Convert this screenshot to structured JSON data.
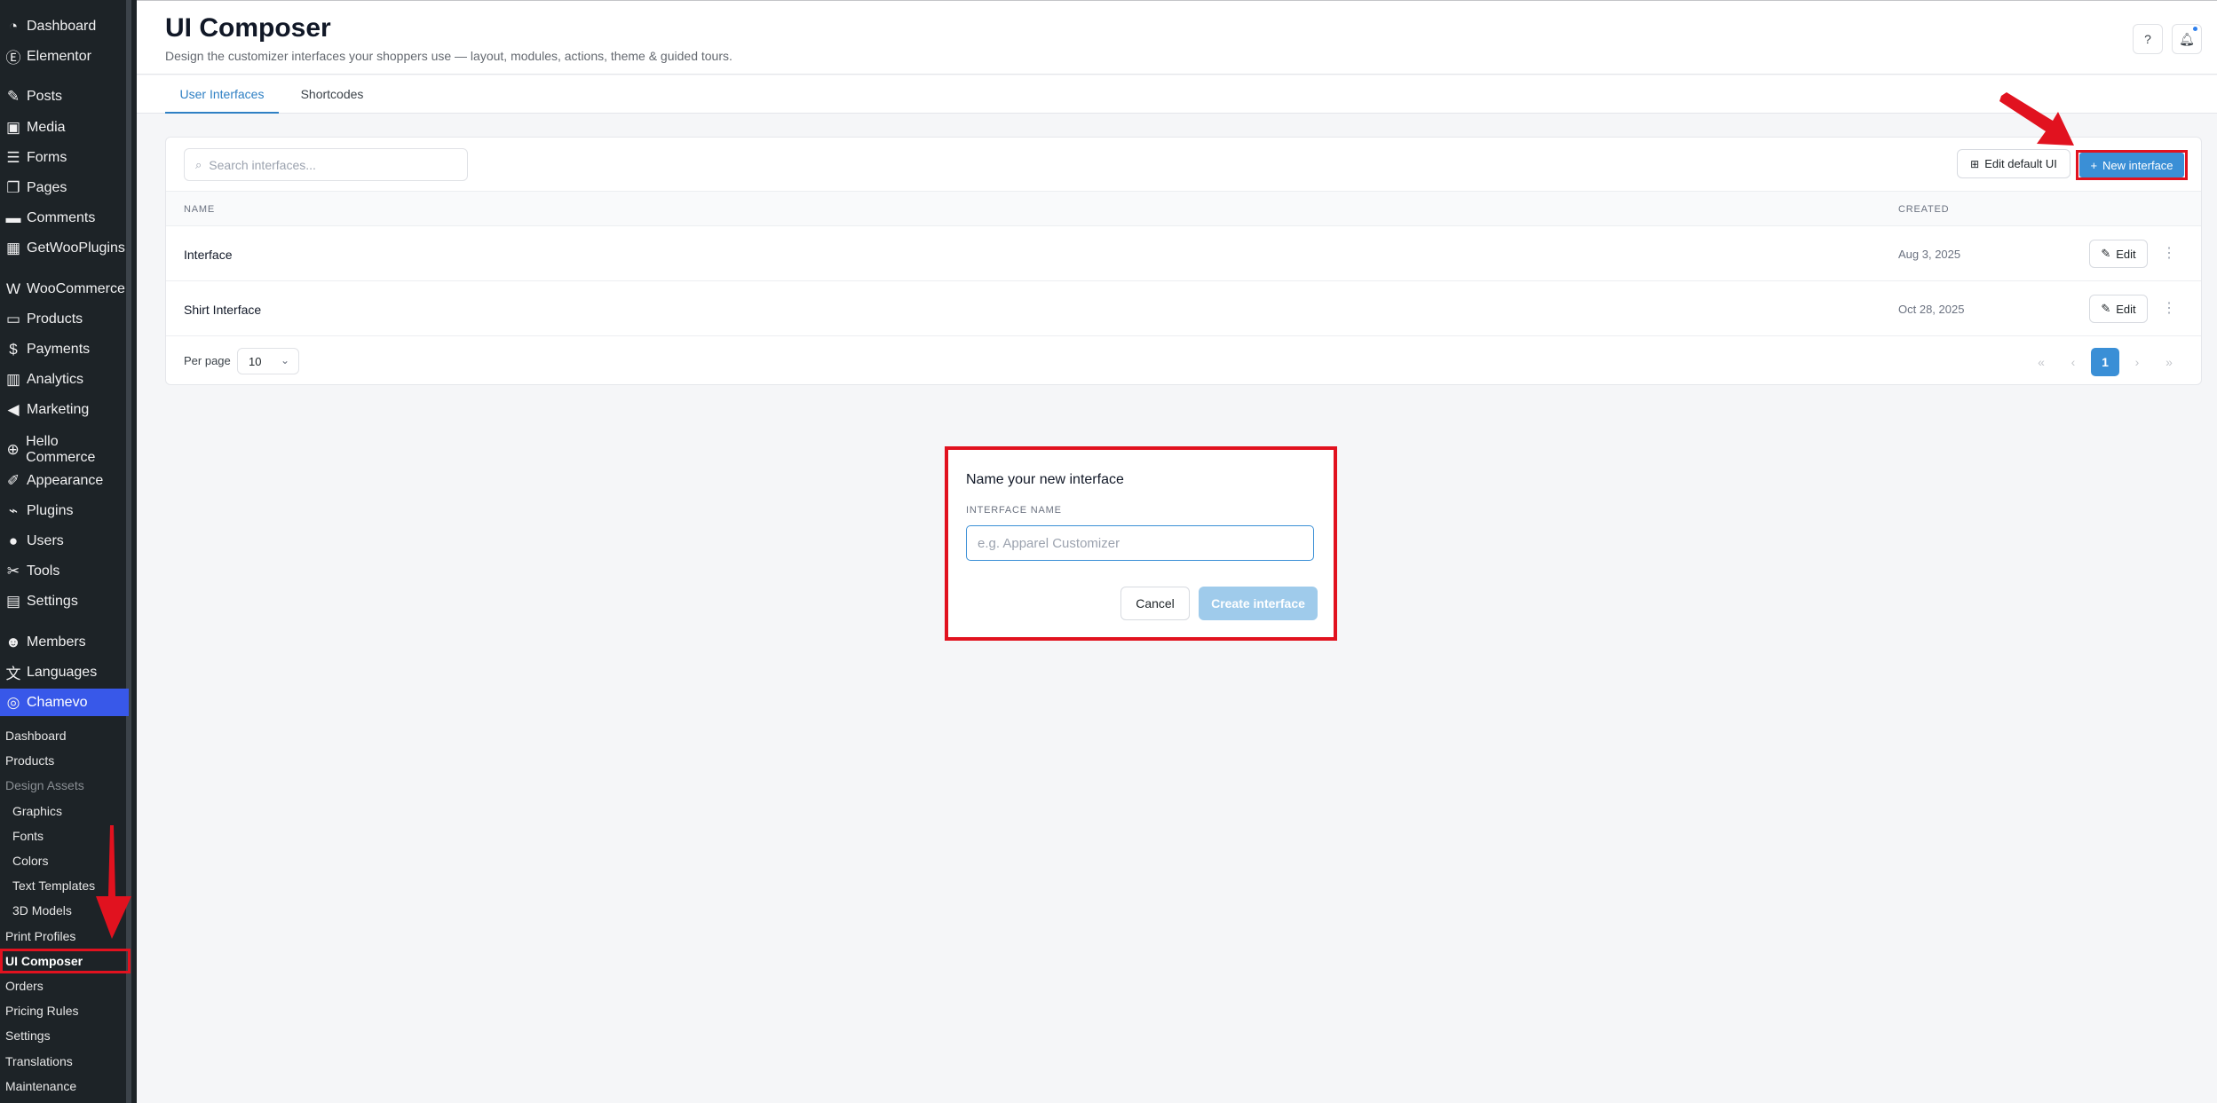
{
  "sidebar": {
    "menu": [
      {
        "label": "Dashboard",
        "icon": "dashboard-icon"
      },
      {
        "label": "Elementor",
        "icon": "elementor-icon"
      },
      {
        "label": "Posts",
        "icon": "pin-icon"
      },
      {
        "label": "Media",
        "icon": "media-icon"
      },
      {
        "label": "Forms",
        "icon": "forms-icon"
      },
      {
        "label": "Pages",
        "icon": "pages-icon"
      },
      {
        "label": "Comments",
        "icon": "comment-icon"
      },
      {
        "label": "GetWooPlugins",
        "icon": "plugins-grid-icon"
      },
      {
        "label": "WooCommerce",
        "icon": "woocommerce-icon"
      },
      {
        "label": "Products",
        "icon": "archive-icon"
      },
      {
        "label": "Payments",
        "icon": "dollar-icon"
      },
      {
        "label": "Analytics",
        "icon": "bar-chart-icon"
      },
      {
        "label": "Marketing",
        "icon": "megaphone-icon"
      },
      {
        "label": "Hello Commerce",
        "icon": "plus-circle-icon"
      },
      {
        "label": "Appearance",
        "icon": "brush-icon"
      },
      {
        "label": "Plugins",
        "icon": "plug-icon"
      },
      {
        "label": "Users",
        "icon": "user-icon"
      },
      {
        "label": "Tools",
        "icon": "wrench-icon"
      },
      {
        "label": "Settings",
        "icon": "settings-icon"
      },
      {
        "label": "Members",
        "icon": "members-icon"
      },
      {
        "label": "Languages",
        "icon": "translate-icon"
      },
      {
        "label": "Chamevo",
        "icon": "chamevo-icon"
      }
    ],
    "submenu": [
      "Dashboard",
      "Products",
      "Design Assets",
      "Graphics",
      "Fonts",
      "Colors",
      "Text Templates",
      "3D Models",
      "Print Profiles",
      "UI Composer",
      "Orders",
      "Pricing Rules",
      "Settings",
      "Translations",
      "Maintenance"
    ]
  },
  "header": {
    "title": "UI Composer",
    "subtitle": "Design the customizer interfaces your shoppers use — layout, modules, actions, theme & guided tours."
  },
  "tabs": [
    "User Interfaces",
    "Shortcodes"
  ],
  "toolbar": {
    "search_placeholder": "Search interfaces...",
    "edit_default_label": "Edit default UI",
    "new_interface_label": "New interface"
  },
  "table": {
    "columns": [
      "NAME",
      "CREATED"
    ],
    "rows": [
      {
        "name": "Interface",
        "created": "Aug 3, 2025",
        "action": "Edit"
      },
      {
        "name": "Shirt Interface",
        "created": "Oct 28, 2025",
        "action": "Edit"
      }
    ]
  },
  "pagination": {
    "per_page_label": "Per page",
    "per_page_value": "10",
    "current_page": "1"
  },
  "dialog": {
    "title": "Name your new interface",
    "field_label": "INTERFACE NAME",
    "placeholder": "e.g. Apparel Customizer",
    "cancel_label": "Cancel",
    "create_label": "Create interface"
  },
  "colors": {
    "accent": "#3a8fd6",
    "sidebar_bg": "#1d2327",
    "sidebar_active": "#3858e9",
    "annotation": "#e1121f"
  }
}
